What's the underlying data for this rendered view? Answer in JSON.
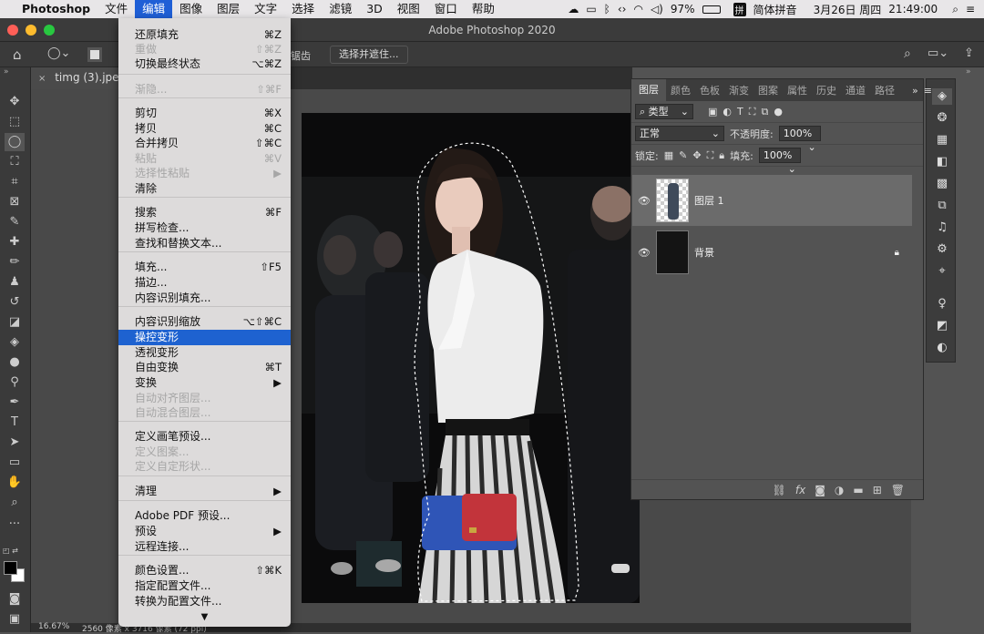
{
  "menubar": {
    "apple": "",
    "app": "Photoshop",
    "items": [
      "文件",
      "编辑",
      "图像",
      "图层",
      "文字",
      "选择",
      "滤镜",
      "3D",
      "视图",
      "窗口",
      "帮助"
    ],
    "active_index": 1,
    "status": {
      "battery": "97%",
      "ime": "简体拼音",
      "date": "3月26日 周四",
      "time": "21:49:00"
    }
  },
  "window": {
    "title": "Adobe Photoshop 2020"
  },
  "options_bar": {
    "sub_label": "锯齿",
    "select_mask_button": "选择并遮住..."
  },
  "document": {
    "tab_title": "timg (3).jpeg @",
    "zoom": "16.67%",
    "doc_info": "2560 像素 x 3716 像素 (72 ppi)"
  },
  "edit_menu": {
    "items": [
      {
        "label": "还原填充",
        "shortcut": "⌘Z",
        "disabled": false
      },
      {
        "label": "重做",
        "shortcut": "⇧⌘Z",
        "disabled": true
      },
      {
        "label": "切换最终状态",
        "shortcut": "⌥⌘Z",
        "disabled": false
      },
      {
        "label": "渐隐...",
        "shortcut": "⇧⌘F",
        "disabled": true
      },
      {
        "label": "剪切",
        "shortcut": "⌘X",
        "disabled": false
      },
      {
        "label": "拷贝",
        "shortcut": "⌘C",
        "disabled": false
      },
      {
        "label": "合并拷贝",
        "shortcut": "⇧⌘C",
        "disabled": false
      },
      {
        "label": "粘贴",
        "shortcut": "⌘V",
        "disabled": true
      },
      {
        "label": "选择性粘贴",
        "shortcut": "▶",
        "disabled": true
      },
      {
        "label": "清除",
        "shortcut": "",
        "disabled": false
      },
      {
        "label": "搜索",
        "shortcut": "⌘F",
        "disabled": false
      },
      {
        "label": "拼写检查...",
        "shortcut": "",
        "disabled": false
      },
      {
        "label": "查找和替换文本...",
        "shortcut": "",
        "disabled": false
      },
      {
        "label": "填充...",
        "shortcut": "⇧F5",
        "disabled": false
      },
      {
        "label": "描边...",
        "shortcut": "",
        "disabled": false
      },
      {
        "label": "内容识别填充...",
        "shortcut": "",
        "disabled": false
      },
      {
        "label": "内容识别缩放",
        "shortcut": "⌥⇧⌘C",
        "disabled": false
      },
      {
        "label": "操控变形",
        "shortcut": "",
        "disabled": false
      },
      {
        "label": "透视变形",
        "shortcut": "",
        "disabled": false
      },
      {
        "label": "自由变换",
        "shortcut": "⌘T",
        "disabled": false
      },
      {
        "label": "变换",
        "shortcut": "▶",
        "disabled": false
      },
      {
        "label": "自动对齐图层...",
        "shortcut": "",
        "disabled": true
      },
      {
        "label": "自动混合图层...",
        "shortcut": "",
        "disabled": true
      },
      {
        "label": "定义画笔预设...",
        "shortcut": "",
        "disabled": false
      },
      {
        "label": "定义图案...",
        "shortcut": "",
        "disabled": true
      },
      {
        "label": "定义自定形状...",
        "shortcut": "",
        "disabled": true
      },
      {
        "label": "清理",
        "shortcut": "▶",
        "disabled": false
      },
      {
        "label": "Adobe PDF 预设...",
        "shortcut": "",
        "disabled": false
      },
      {
        "label": "预设",
        "shortcut": "▶",
        "disabled": false
      },
      {
        "label": "远程连接...",
        "shortcut": "",
        "disabled": false
      },
      {
        "label": "颜色设置...",
        "shortcut": "⇧⌘K",
        "disabled": false
      },
      {
        "label": "指定配置文件...",
        "shortcut": "",
        "disabled": false
      },
      {
        "label": "转换为配置文件...",
        "shortcut": "",
        "disabled": false
      }
    ],
    "highlighted": "操控变形",
    "more": "▼"
  },
  "layers_panel": {
    "tabs": [
      "图层",
      "颜色",
      "色板",
      "渐变",
      "图案",
      "属性",
      "历史",
      "通道",
      "路径"
    ],
    "filter_label": "类型",
    "blend_mode": "正常",
    "opacity_label": "不透明度:",
    "opacity": "100%",
    "lock_label": "锁定:",
    "fill_label": "填充:",
    "fill": "100%",
    "layers": [
      {
        "name": "图层 1",
        "visible": true,
        "selected": true,
        "locked": false
      },
      {
        "name": "背景",
        "visible": true,
        "selected": false,
        "locked": true
      }
    ],
    "footer_icons": [
      "link-icon",
      "fx-icon",
      "mask-icon",
      "adjustment-icon",
      "group-icon",
      "new-layer-icon",
      "trash-icon"
    ]
  },
  "colors": {
    "menu_highlight": "#1e62d0",
    "menu_bg": "#dddbdb",
    "panel_bg": "#535353"
  }
}
